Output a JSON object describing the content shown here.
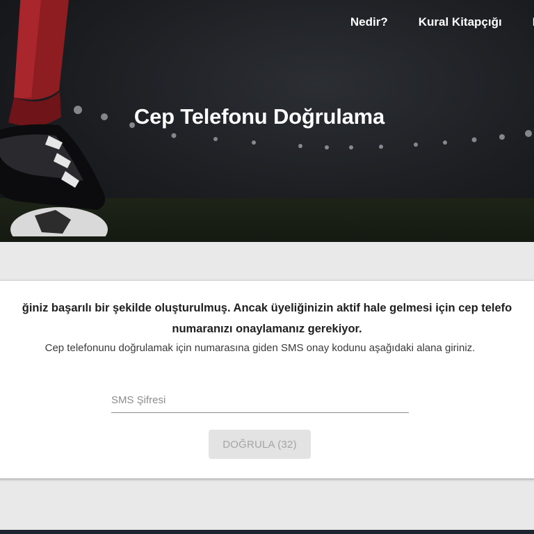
{
  "nav": {
    "items": [
      {
        "label": "Nedir?"
      },
      {
        "label": "Kural Kitapçığı"
      },
      {
        "label": "B"
      }
    ]
  },
  "hero": {
    "title": "Cep Telefonu Doğrulama"
  },
  "card": {
    "message_line1": "ğiniz başarılı bir şekilde oluşturulmuş. Ancak üyeliğinizin aktif hale gelmesi için cep telefo",
    "message_line2": "numaranızı onaylamanız gerekiyor.",
    "hint": "Cep telefonunu doğrulamak için numarasına giden SMS onay kodunu aşağıdaki alana giriniz.",
    "sms_input": {
      "value": "",
      "placeholder": "SMS Şifresi"
    },
    "verify_button": {
      "label": "DOĞRULA (32)",
      "disabled": true
    }
  },
  "colors": {
    "hero_bg": "#1b1d21",
    "page_bg": "#e9e9e9",
    "button_bg": "#e3e3e3",
    "button_text": "#a4a4a4",
    "footer": "#1d2530",
    "sock_red": "#8e1d22"
  }
}
